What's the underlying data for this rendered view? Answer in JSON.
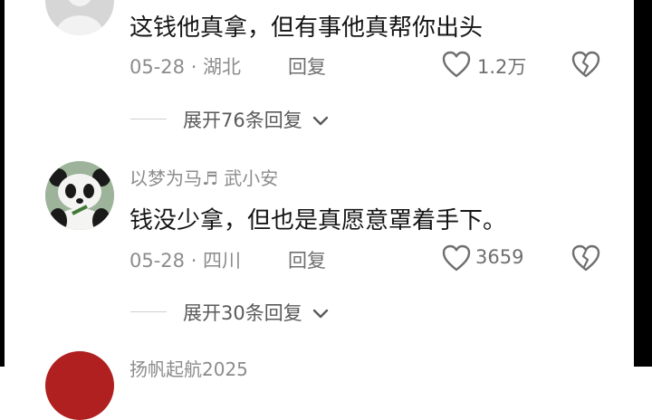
{
  "comments": [
    {
      "text": "这钱他真拿，但有事他真帮你出头",
      "meta": "05-28 · 湖北",
      "reply_label": "回复",
      "like_count": "1.2万",
      "expand_label": "展开76条回复"
    },
    {
      "username": "以梦为马♬ 武小安",
      "text": "钱没少拿，但也是真愿意罩着手下。",
      "meta": "05-28 · 四川",
      "reply_label": "回复",
      "like_count": "3659",
      "expand_label": "展开30条回复"
    },
    {
      "username": "扬帆起航2025"
    }
  ],
  "colors": {
    "text": "#151515",
    "meta": "#8c8c8c",
    "icon": "#6f6f6f"
  }
}
